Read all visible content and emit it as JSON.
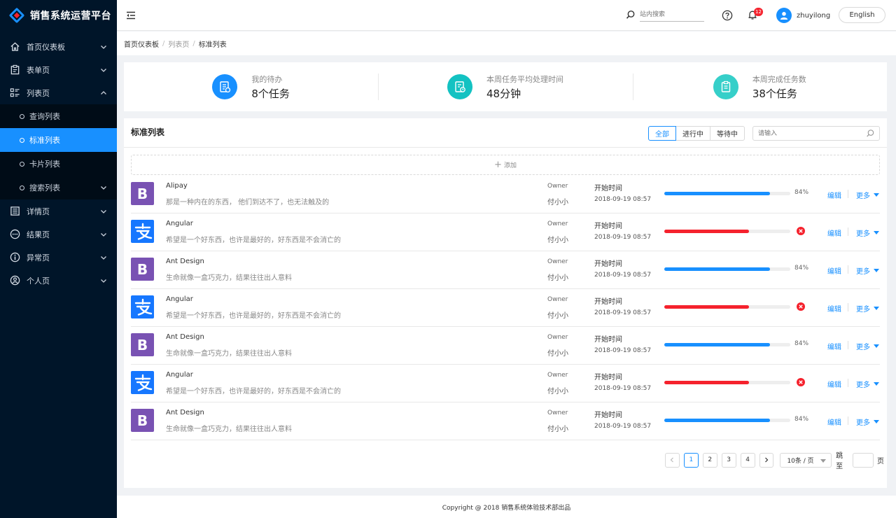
{
  "app": {
    "title": "销售系统运营平台"
  },
  "sidebar": {
    "items": [
      {
        "label": "首页仪表板",
        "icon": "home-icon"
      },
      {
        "label": "表单页",
        "icon": "clipboard-icon"
      },
      {
        "label": "列表页",
        "icon": "list-grid-icon",
        "expanded": true,
        "children": [
          {
            "label": "查询列表"
          },
          {
            "label": "标准列表",
            "active": true
          },
          {
            "label": "卡片列表"
          },
          {
            "label": "搜索列表",
            "hasChildren": true
          }
        ]
      },
      {
        "label": "详情页",
        "icon": "detail-icon"
      },
      {
        "label": "结果页",
        "icon": "ellipsis-circle-icon"
      },
      {
        "label": "异常页",
        "icon": "info-circle-icon"
      },
      {
        "label": "个人页",
        "icon": "user-circle-icon"
      }
    ]
  },
  "header": {
    "search_placeholder": "站内搜索",
    "notification_count": "12",
    "username": "zhuyilong",
    "lang_label": "English"
  },
  "breadcrumb": [
    "首页仪表板",
    "列表页",
    "标准列表"
  ],
  "stats": [
    {
      "label": "我的待办",
      "value": "8个任务",
      "color": "#1890ff"
    },
    {
      "label": "本周任务平均处理时间",
      "value": "48分钟",
      "color": "#13c2c2"
    },
    {
      "label": "本周完成任务数",
      "value": "38个任务",
      "color": "#36cfc9"
    }
  ],
  "list": {
    "title": "标准列表",
    "filters": [
      "全部",
      "进行中",
      "等待中"
    ],
    "active_filter": 0,
    "search_placeholder": "请输入",
    "add_label": "添加",
    "edit_label": "编辑",
    "more_label": "更多",
    "rows": [
      {
        "logo": "B",
        "type": "b",
        "name": "Alipay",
        "desc": "那是一种内在的东西， 他们到达不了，也无法触及的",
        "owner_label": "Owner",
        "owner": "付小小",
        "time_label": "开始时间",
        "time": "2018-09-19 08:57",
        "progress": 84,
        "status": "normal",
        "pct_text": "84%"
      },
      {
        "logo": "支",
        "type": "z",
        "name": "Angular",
        "desc": "希望是一个好东西，也许是最好的，好东西是不会消亡的",
        "owner_label": "Owner",
        "owner": "付小小",
        "time_label": "开始时间",
        "time": "2018-09-19 08:57",
        "progress": 67,
        "status": "exception",
        "pct_text": ""
      },
      {
        "logo": "B",
        "type": "b",
        "name": "Ant Design",
        "desc": "生命就像一盒巧克力，结果往往出人意料",
        "owner_label": "Owner",
        "owner": "付小小",
        "time_label": "开始时间",
        "time": "2018-09-19 08:57",
        "progress": 84,
        "status": "normal",
        "pct_text": "84%"
      },
      {
        "logo": "支",
        "type": "z",
        "name": "Angular",
        "desc": "希望是一个好东西，也许是最好的，好东西是不会消亡的",
        "owner_label": "Owner",
        "owner": "付小小",
        "time_label": "开始时间",
        "time": "2018-09-19 08:57",
        "progress": 67,
        "status": "exception",
        "pct_text": ""
      },
      {
        "logo": "B",
        "type": "b",
        "name": "Ant Design",
        "desc": "生命就像一盒巧克力，结果往往出人意料",
        "owner_label": "Owner",
        "owner": "付小小",
        "time_label": "开始时间",
        "time": "2018-09-19 08:57",
        "progress": 84,
        "status": "normal",
        "pct_text": "84%"
      },
      {
        "logo": "支",
        "type": "z",
        "name": "Angular",
        "desc": "希望是一个好东西，也许是最好的，好东西是不会消亡的",
        "owner_label": "Owner",
        "owner": "付小小",
        "time_label": "开始时间",
        "time": "2018-09-19 08:57",
        "progress": 67,
        "status": "exception",
        "pct_text": ""
      },
      {
        "logo": "B",
        "type": "b",
        "name": "Ant Design",
        "desc": "生命就像一盒巧克力，结果往往出人意料",
        "owner_label": "Owner",
        "owner": "付小小",
        "time_label": "开始时间",
        "time": "2018-09-19 08:57",
        "progress": 84,
        "status": "normal",
        "pct_text": "84%"
      }
    ]
  },
  "pagination": {
    "pages": [
      "1",
      "2",
      "3",
      "4"
    ],
    "current": "1",
    "page_size": "10条 / 页",
    "jump_label": "跳至",
    "page_suffix": "页"
  },
  "footer": {
    "text": "Copyright @ 2018 销售系统体验技术部出品"
  },
  "colors": {
    "primary": "#1890ff",
    "exception": "#f5222d",
    "sidebar": "#001529"
  }
}
